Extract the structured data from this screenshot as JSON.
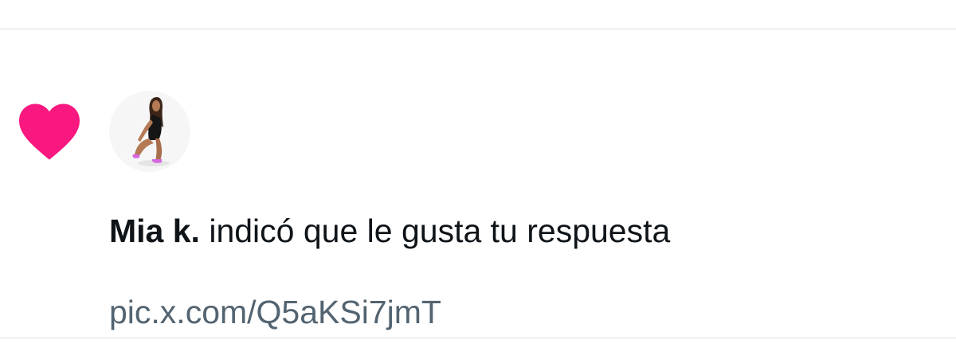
{
  "notification": {
    "type_icon": "heart-icon",
    "user_name": "Mia k.",
    "action_text": "indicó que le gusta tu respuesta",
    "media_link": "pic.x.com/Q5aKSi7jmT"
  },
  "colors": {
    "heart": "#f91880",
    "text_primary": "#0f1419",
    "text_secondary": "#536471",
    "divider": "#eff3f4"
  }
}
